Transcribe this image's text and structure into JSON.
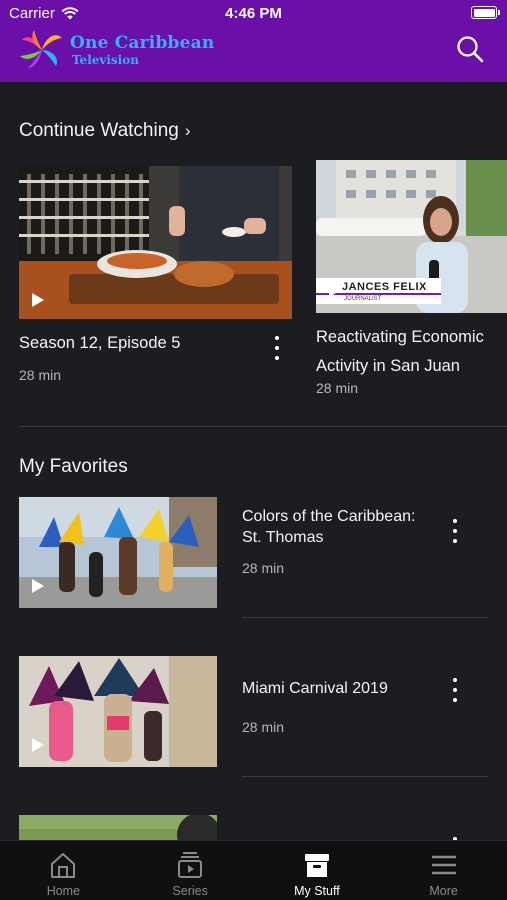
{
  "status_bar": {
    "carrier": "Carrier",
    "time": "4:46 PM"
  },
  "header": {
    "logo_title": "One Caribbean",
    "logo_subtitle": "Television",
    "search_icon": "search-icon",
    "background": "#6a0fa8",
    "logo_color": "#2fb2ff"
  },
  "continue_watching": {
    "title": "Continue Watching",
    "items": [
      {
        "title": "Season 12, Episode 5",
        "duration": "28 min"
      },
      {
        "title": "Reactivating Economic Activity in San Juan",
        "duration": "28 min",
        "lower_third": "JANCES FELIX",
        "lower_third_sub": "JOURNALIST"
      }
    ]
  },
  "favorites": {
    "title": "My Favorites",
    "items": [
      {
        "title": "Colors of the Caribbean: St. Thomas",
        "duration": "28 min"
      },
      {
        "title": "Miami Carnival 2019",
        "duration": "28 min"
      }
    ]
  },
  "tabs": [
    {
      "label": "Home",
      "icon": "home-icon"
    },
    {
      "label": "Series",
      "icon": "series-icon"
    },
    {
      "label": "My Stuff",
      "icon": "my-stuff-icon",
      "active": true
    },
    {
      "label": "More",
      "icon": "menu-icon"
    }
  ]
}
